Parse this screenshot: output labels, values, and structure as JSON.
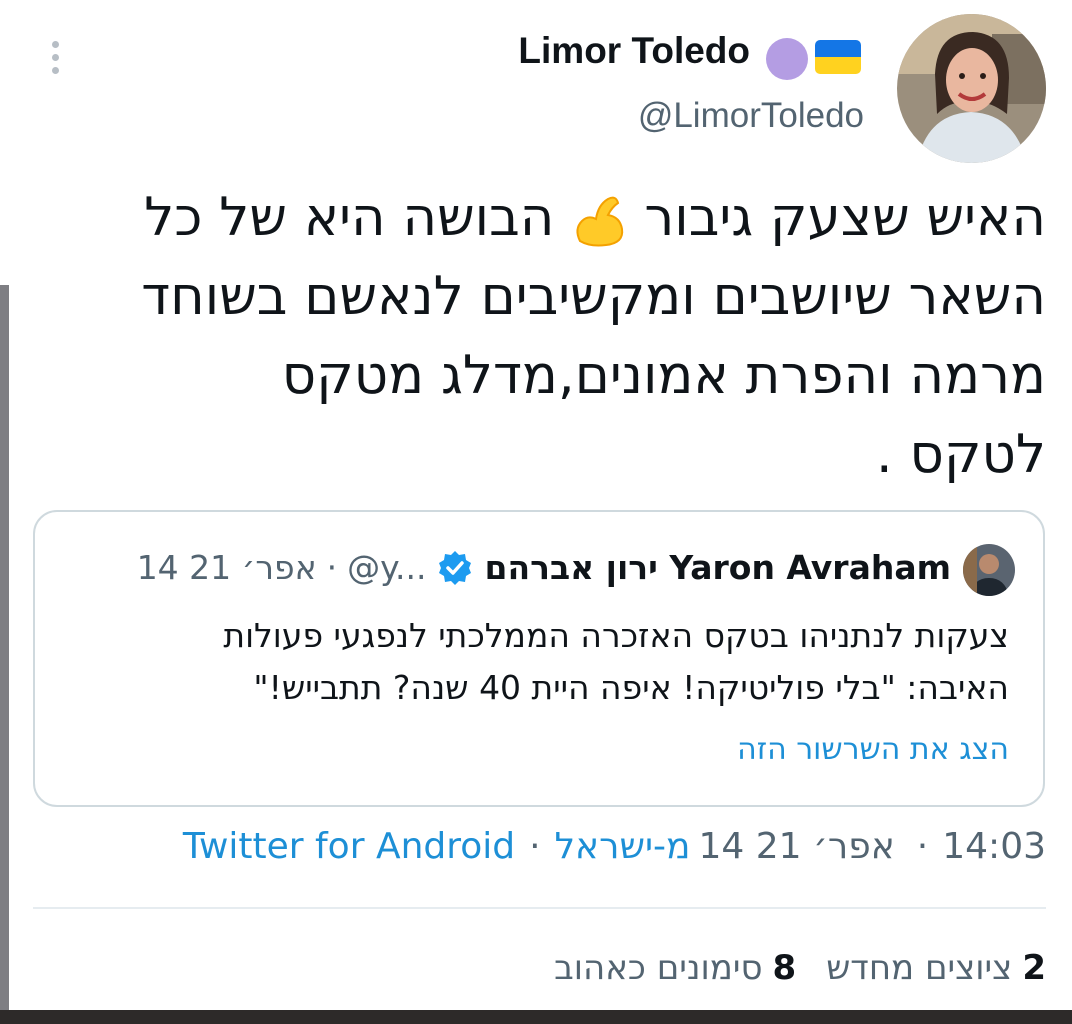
{
  "author": {
    "display_name": "Limor Toledo",
    "handle": "@LimorToledo",
    "badges": [
      "purple-circle-icon",
      "ukraine-flag-icon"
    ]
  },
  "tweet": {
    "lines": [
      "האיש שצעק גיבור",
      "הבושה היא של כל",
      "השאר שיושבים ומקשיבים לנאשם בשוחד",
      "מרמה והפרת אמונים,מדלג מטקס",
      "לטקס ."
    ],
    "emoji": "flexed-biceps-icon"
  },
  "quoted_tweet": {
    "name": "ירון אברהם Yaron Avraham",
    "handle": "@y...",
    "date": "14 אפר׳ 21",
    "separator": "·",
    "text_lines": [
      "צעקות לנתניהו בטקס האזכרה הממלכתי לנפגעי פעולות",
      "האיבה: \"בלי פוליטיקה! איפה היית 40 שנה? תתבייש!\""
    ],
    "show_thread": "הצג את השרשור הזה"
  },
  "meta": {
    "time": "14:03",
    "date": "14 אפר׳ 21",
    "location": "מ-ישראל",
    "source": "Twitter for Android",
    "separator": "·"
  },
  "stats": {
    "retweets_count": "2",
    "retweets_label": "ציוצים מחדש",
    "likes_count": "8",
    "likes_label": "סימונים כאהוב"
  },
  "colors": {
    "link": "#1d8fd6",
    "secondary_text": "#536471",
    "border": "#cfd9de",
    "verified": "#1d9bf0"
  }
}
